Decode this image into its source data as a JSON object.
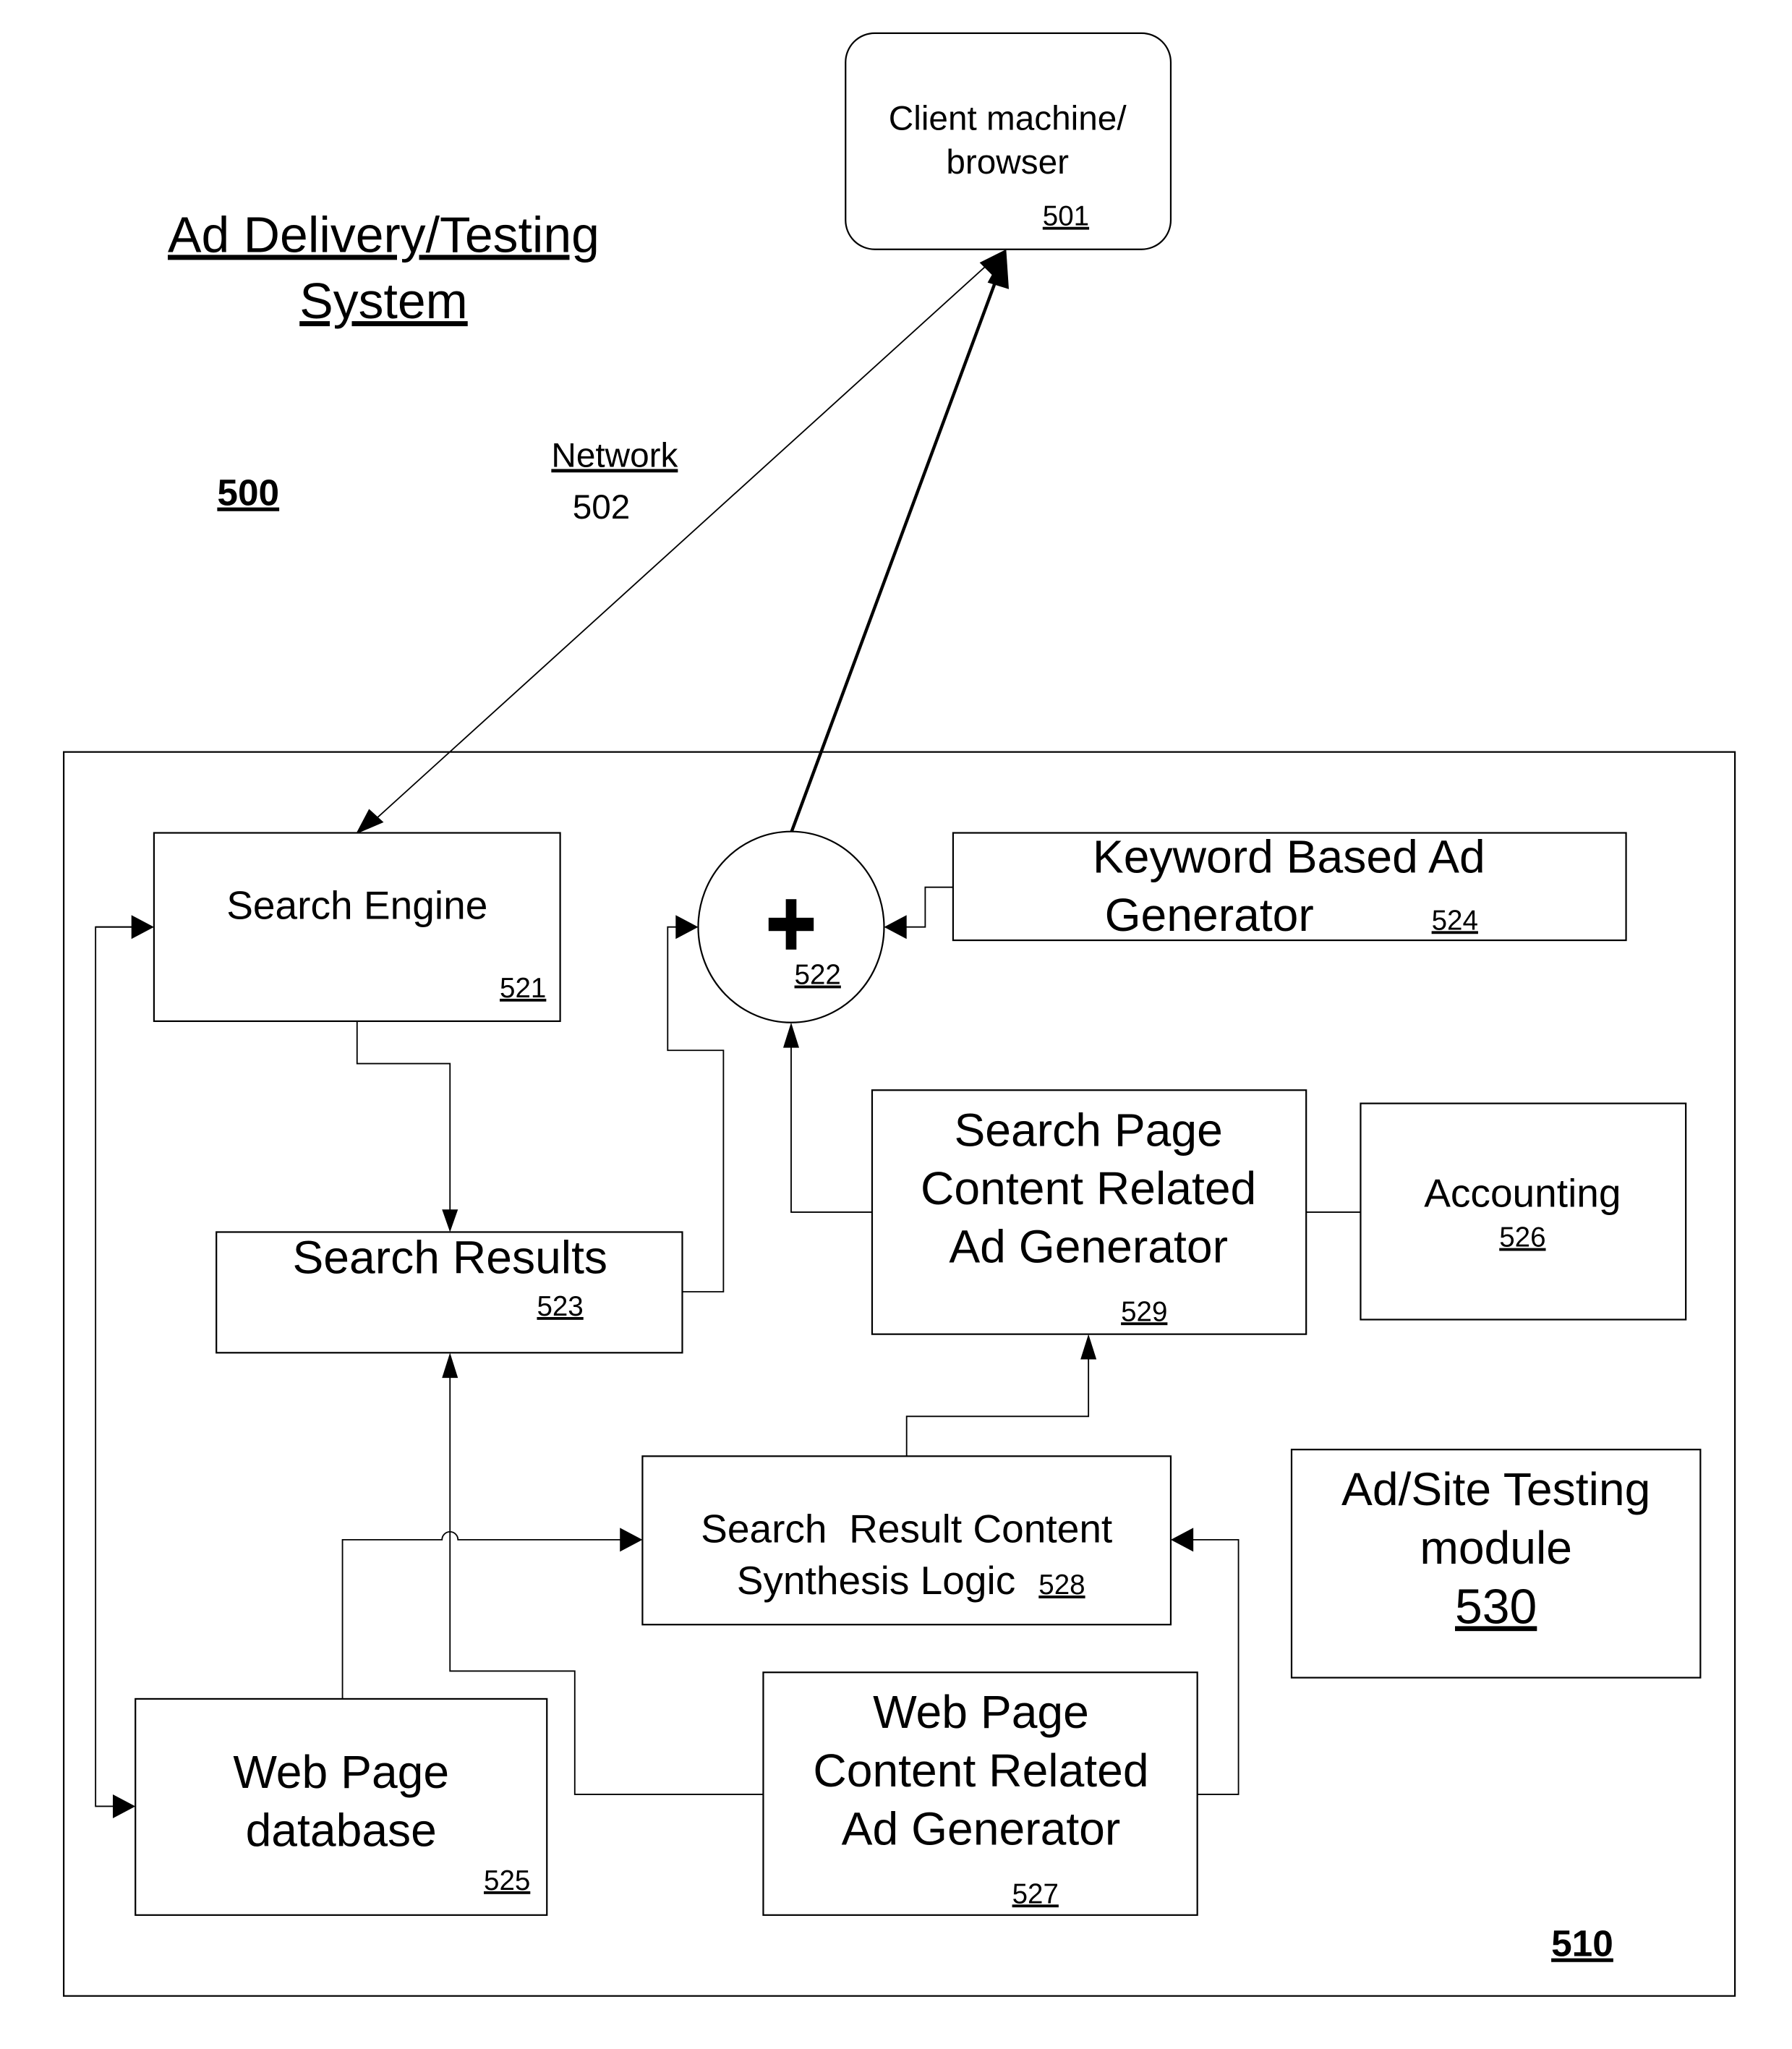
{
  "figure": {
    "title_lines": [
      "Ad Delivery/Testing",
      "System"
    ],
    "system_ref": "500",
    "server_ref": "510"
  },
  "network": {
    "label": "Network",
    "ref": "502"
  },
  "client": {
    "lines": [
      "Client machine/",
      "browser"
    ],
    "ref": "501"
  },
  "blocks": {
    "search_engine": {
      "lines": [
        "Search Engine"
      ],
      "ref": "521"
    },
    "combiner": {
      "symbol": "+",
      "ref": "522"
    },
    "keyword_ad_generator": {
      "lines": [
        "Keyword Based Ad",
        "Generator"
      ],
      "ref": "524"
    },
    "search_results": {
      "lines": [
        "Search Results"
      ],
      "ref": "523"
    },
    "search_page_ad_generator": {
      "lines": [
        "Search Page",
        "Content Related",
        "Ad Generator"
      ],
      "ref": "529"
    },
    "accounting": {
      "lines": [
        "Accounting"
      ],
      "ref": "526"
    },
    "synthesis_logic": {
      "lines": [
        "Search  Result Content",
        "Synthesis Logic"
      ],
      "ref": "528"
    },
    "testing_module": {
      "lines": [
        "Ad/Site Testing",
        "module"
      ],
      "ref": "530"
    },
    "web_page_database": {
      "lines": [
        "Web Page",
        "database"
      ],
      "ref": "525"
    },
    "web_page_ad_generator": {
      "lines": [
        "Web Page",
        "Content Related",
        "Ad Generator"
      ],
      "ref": "527"
    }
  }
}
